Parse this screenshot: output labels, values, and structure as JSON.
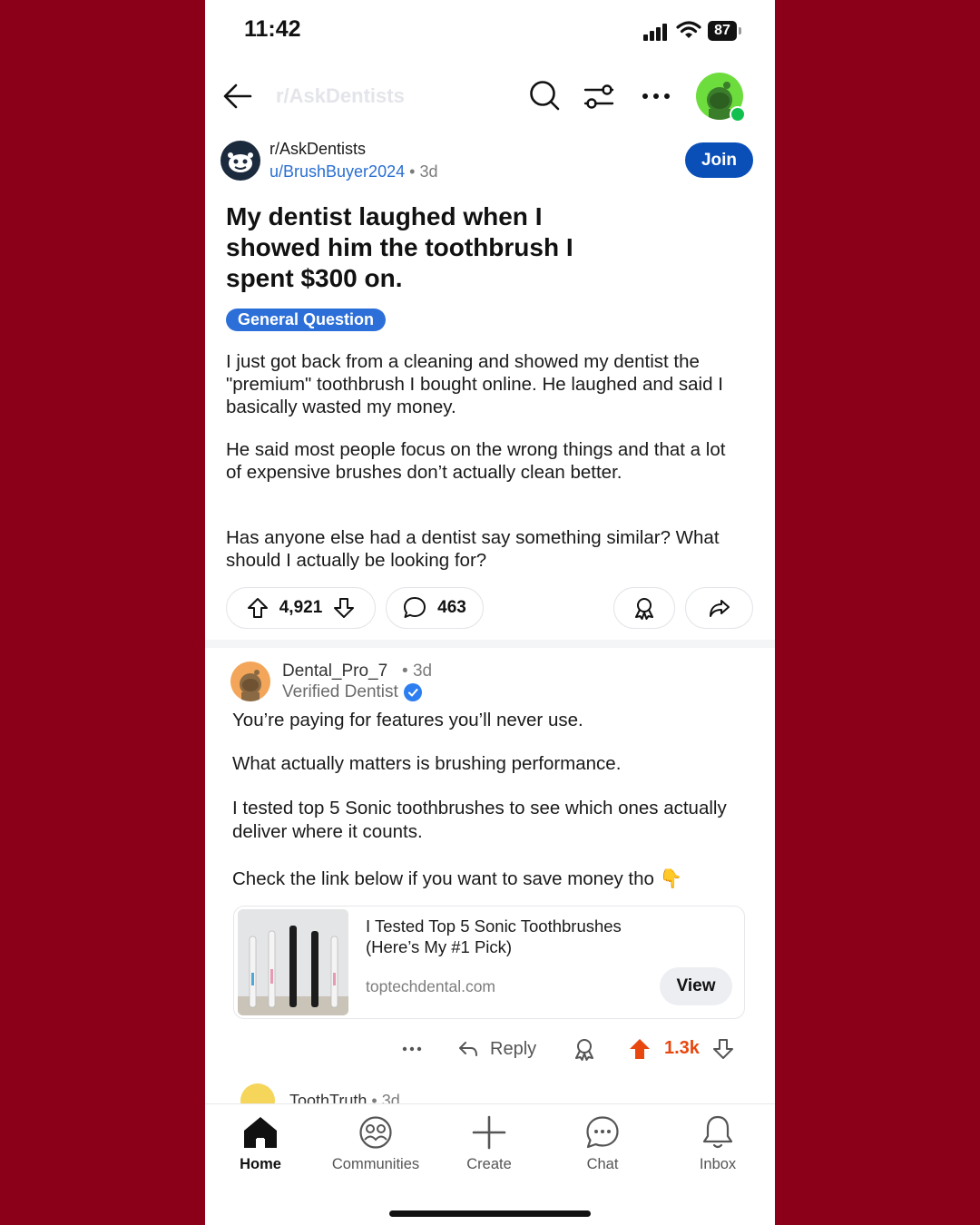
{
  "status_bar": {
    "time": "11:42",
    "battery": "87"
  },
  "nav": {
    "title": "r/AskDentists"
  },
  "post": {
    "subreddit": "r/AskDentists",
    "author": "u/BrushBuyer2024",
    "age": "3d",
    "join_label": "Join",
    "title": "My dentist laughed when I showed him the toothbrush I spent $300 on.",
    "flair": "General Question",
    "paragraphs": [
      "I just got back from a cleaning and showed my dentist the \"premium\" toothbrush I bought online. He laughed and said I basically wasted my money.",
      "He said most people focus on the wrong things and that a lot of expensive brushes don’t actually clean better.",
      "Has anyone else had a dentist say something similar? What should I actually be looking for?"
    ],
    "votes": "4,921",
    "comments": "463"
  },
  "comment": {
    "username": "Dental_Pro_7",
    "age": "3d",
    "user_flair": "Verified Dentist",
    "paragraphs": [
      "You’re paying for features you’ll never use.",
      "What actually matters is brushing performance.",
      "I tested top 5 Sonic toothbrushes to see which ones actually deliver where it counts.",
      "Check the link below if you want to save money tho 👇"
    ],
    "link": {
      "title": "I Tested Top 5 Sonic Toothbrushes (Here’s My #1 Pick)",
      "domain": "toptechdental.com",
      "view_label": "View"
    },
    "reply_label": "Reply",
    "score": "1.3k"
  },
  "next_comment": {
    "username": "ToothTruth",
    "age": "3d"
  },
  "tabs": [
    {
      "label": "Home",
      "icon": "home-icon",
      "active": true
    },
    {
      "label": "Communities",
      "icon": "communities-icon",
      "active": false
    },
    {
      "label": "Create",
      "icon": "plus-icon",
      "active": false
    },
    {
      "label": "Chat",
      "icon": "chat-icon",
      "active": false
    },
    {
      "label": "Inbox",
      "icon": "bell-icon",
      "active": false
    }
  ],
  "colors": {
    "background": "#8b0018",
    "join_button": "#0a4fb8",
    "flair": "#2d6fd8",
    "link_blue": "#2a6fd1",
    "upvote_orange": "#e8470f",
    "online_green": "#12c050"
  }
}
